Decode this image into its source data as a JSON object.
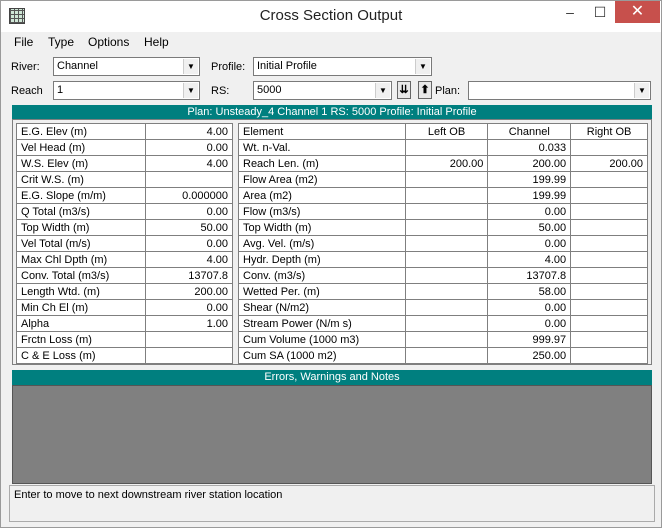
{
  "window": {
    "title": "Cross Section Output",
    "controls": {
      "minimize": "–",
      "maximize": "☐",
      "close": "✕"
    }
  },
  "menu": [
    "File",
    "Type",
    "Options",
    "Help"
  ],
  "selectors": {
    "river_label": "River:",
    "river_value": "Channel",
    "profile_label": "Profile:",
    "profile_value": "Initial Profile",
    "reach_label": "Reach",
    "reach_value": "1",
    "rs_label": "RS:",
    "rs_value": "5000",
    "plan_label": "Plan:",
    "plan_value": "",
    "down_button": "⇊",
    "up_button": "⬆"
  },
  "banner": "Plan: Unsteady_4     Channel     1  RS: 5000     Profile: Initial Profile",
  "left_table": [
    [
      "E.G. Elev (m)",
      "4.00"
    ],
    [
      "Vel Head (m)",
      "0.00"
    ],
    [
      "W.S. Elev (m)",
      "4.00"
    ],
    [
      "Crit W.S. (m)",
      ""
    ],
    [
      "E.G. Slope (m/m)",
      "0.000000"
    ],
    [
      "Q Total (m3/s)",
      "0.00"
    ],
    [
      "Top Width (m)",
      "50.00"
    ],
    [
      "Vel Total (m/s)",
      "0.00"
    ],
    [
      "Max Chl Dpth (m)",
      "4.00"
    ],
    [
      "Conv. Total (m3/s)",
      "13707.8"
    ],
    [
      "Length Wtd. (m)",
      "200.00"
    ],
    [
      "Min Ch El (m)",
      "0.00"
    ],
    [
      "Alpha",
      "1.00"
    ],
    [
      "Frctn Loss (m)",
      ""
    ],
    [
      "C & E Loss (m)",
      ""
    ]
  ],
  "right_table": {
    "headers": [
      "Element",
      "Left OB",
      "Channel",
      "Right OB"
    ],
    "rows": [
      [
        "Wt. n-Val.",
        "",
        "0.033",
        ""
      ],
      [
        "Reach Len. (m)",
        "200.00",
        "200.00",
        "200.00"
      ],
      [
        "Flow Area (m2)",
        "",
        "199.99",
        ""
      ],
      [
        "Area (m2)",
        "",
        "199.99",
        ""
      ],
      [
        "Flow (m3/s)",
        "",
        "0.00",
        ""
      ],
      [
        "Top Width (m)",
        "",
        "50.00",
        ""
      ],
      [
        "Avg. Vel. (m/s)",
        "",
        "0.00",
        ""
      ],
      [
        "Hydr. Depth (m)",
        "",
        "4.00",
        ""
      ],
      [
        "Conv. (m3/s)",
        "",
        "13707.8",
        ""
      ],
      [
        "Wetted Per. (m)",
        "",
        "58.00",
        ""
      ],
      [
        "Shear (N/m2)",
        "",
        "0.00",
        ""
      ],
      [
        "Stream Power (N/m s)",
        "",
        "0.00",
        ""
      ],
      [
        "Cum Volume (1000 m3)",
        "",
        "999.97",
        ""
      ],
      [
        "Cum SA (1000 m2)",
        "",
        "250.00",
        ""
      ]
    ]
  },
  "errors_title": "Errors, Warnings and Notes",
  "status_text": "Enter to move to next downstream river station location"
}
